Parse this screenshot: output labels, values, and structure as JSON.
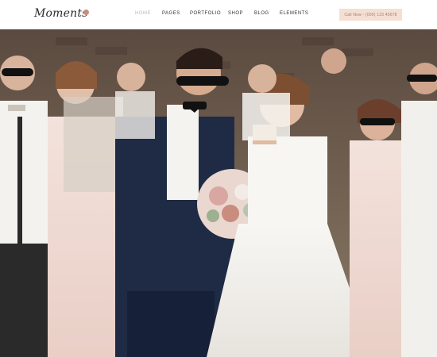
{
  "header": {
    "logo": "Moments",
    "nav": [
      {
        "label": "HOME",
        "active": true
      },
      {
        "label": "PAGES",
        "active": false
      },
      {
        "label": "PORTFOLIO",
        "active": false
      },
      {
        "label": "SHOP",
        "active": false
      },
      {
        "label": "BLOG",
        "active": false
      },
      {
        "label": "ELEMENTS",
        "active": false
      }
    ],
    "cta": "Call Now - (000) 123 45678"
  },
  "hero": {
    "slides_count": 7,
    "active_slide_index": 0
  },
  "colors": {
    "accent": "#c98c7e",
    "cta_bg": "#f5dfd3",
    "nav_active": "#b9b9b9"
  }
}
